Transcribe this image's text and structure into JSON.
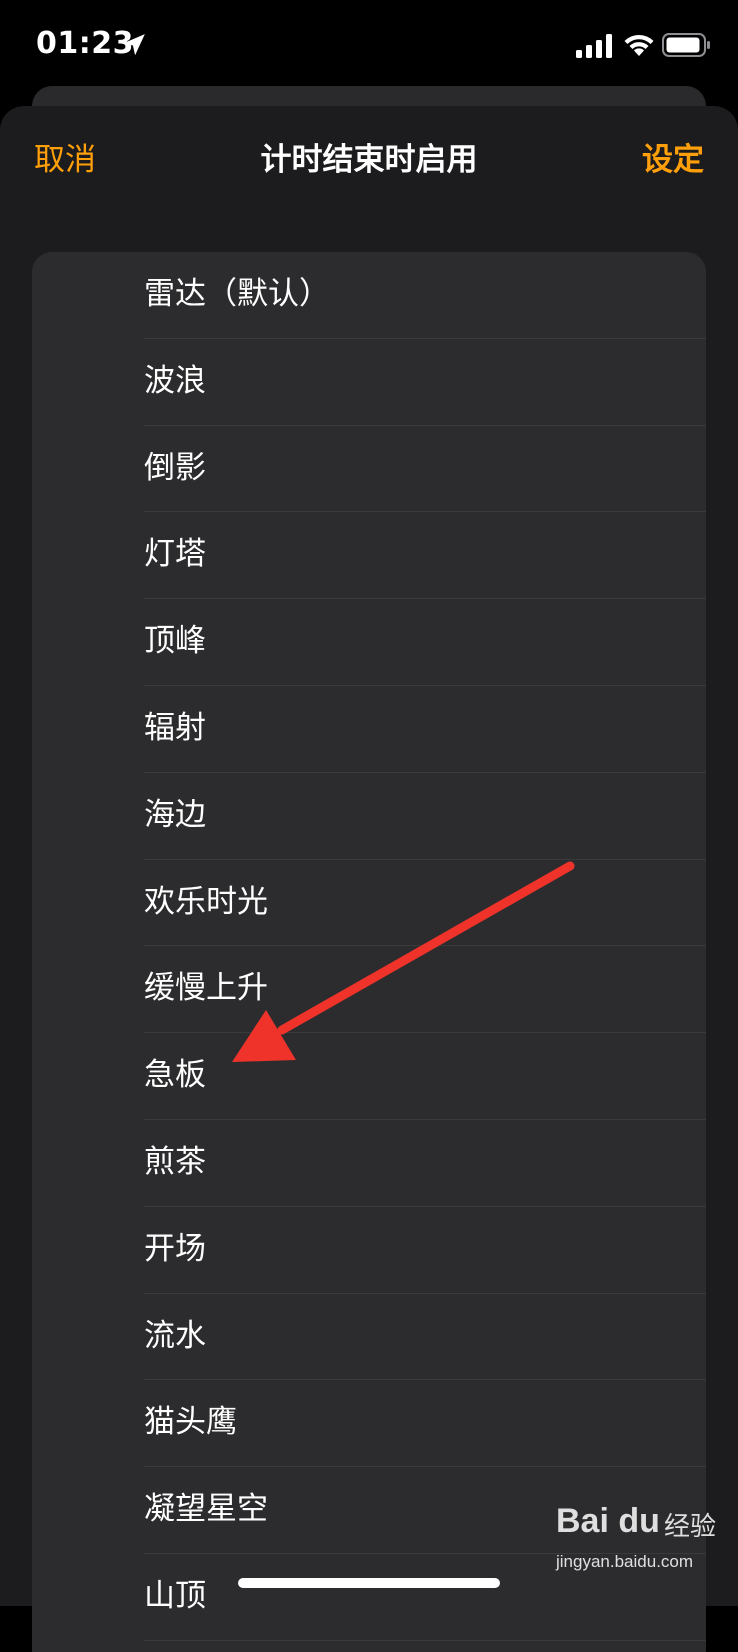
{
  "status_bar": {
    "time": "01:23",
    "icons": [
      "location-arrow-icon",
      "cellular-signal-icon",
      "wifi-icon",
      "battery-icon"
    ]
  },
  "nav": {
    "cancel_label": "取消",
    "title": "计时结束时启用",
    "set_label": "设定"
  },
  "sounds": [
    {
      "label": "雷达（默认）"
    },
    {
      "label": "波浪"
    },
    {
      "label": "倒影"
    },
    {
      "label": "灯塔"
    },
    {
      "label": "顶峰"
    },
    {
      "label": "辐射"
    },
    {
      "label": "海边"
    },
    {
      "label": "欢乐时光"
    },
    {
      "label": "缓慢上升"
    },
    {
      "label": "急板"
    },
    {
      "label": "煎茶"
    },
    {
      "label": "开场"
    },
    {
      "label": "流水"
    },
    {
      "label": "猫头鹰"
    },
    {
      "label": "凝望星空"
    },
    {
      "label": "山顶"
    }
  ],
  "annotation": {
    "color": "#f0332a",
    "points_to": "急板"
  },
  "watermark": {
    "logo": "Bai du",
    "text": "经验",
    "url": "jingyan.baidu.com"
  },
  "colors": {
    "accent": "#ff9f0a",
    "sheet_bg": "#1c1c1e",
    "list_bg": "#2c2c2e",
    "separator": "#3a3a3c"
  }
}
